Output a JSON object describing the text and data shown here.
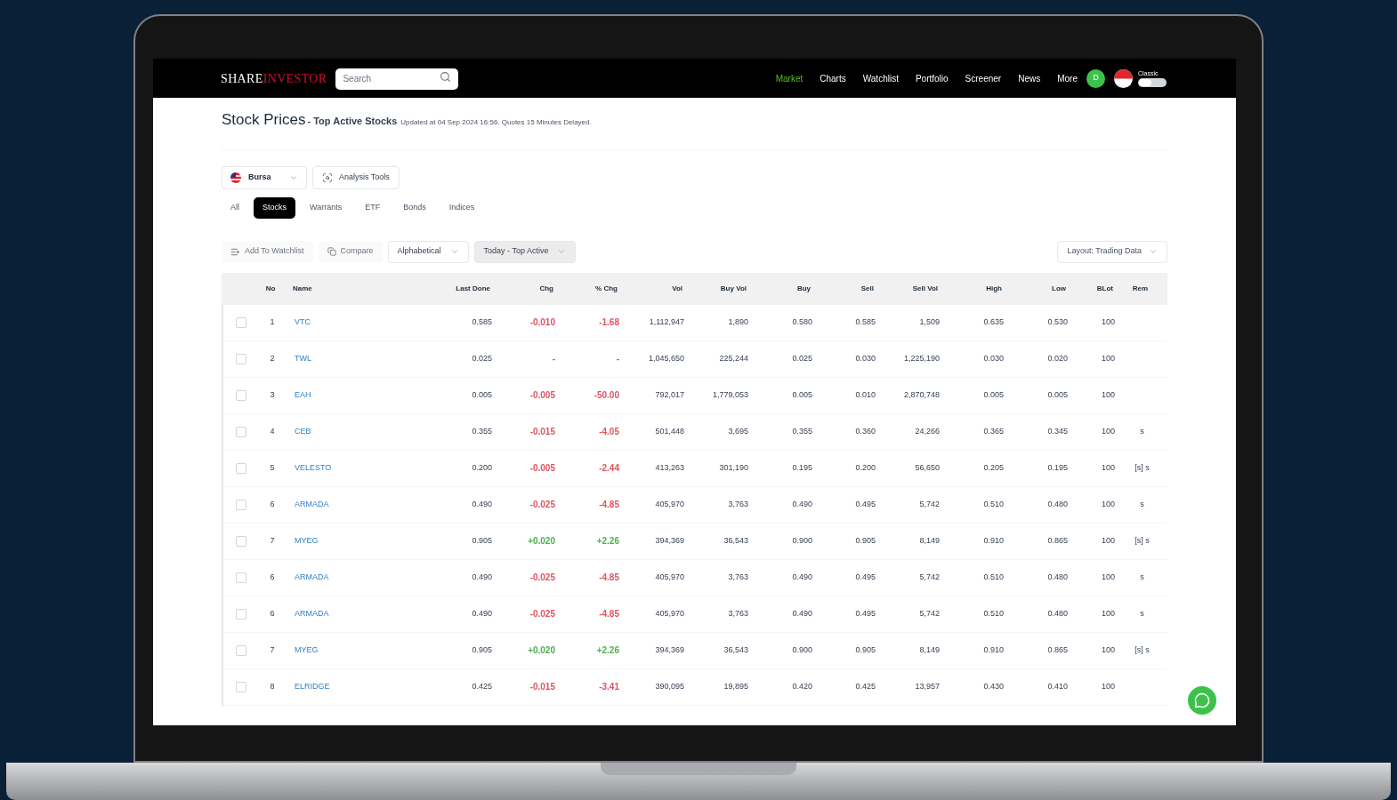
{
  "navbar": {
    "logo": [
      "SHARE",
      "INVESTOR"
    ],
    "search": {
      "placeholder": "Search"
    },
    "links": [
      {
        "label": "Market",
        "selected": true
      },
      {
        "label": "Charts",
        "selected": false
      },
      {
        "label": "Watchlist",
        "selected": false
      },
      {
        "label": "Portfolio",
        "selected": false
      },
      {
        "label": "Screener",
        "selected": false
      },
      {
        "label": "News",
        "selected": false
      },
      {
        "label": "More",
        "selected": false
      }
    ],
    "avatar": "D",
    "classic": {
      "label": "Classic",
      "on": false
    }
  },
  "page": {
    "title": "Stock Prices",
    "subtitle": "- Top Active Stocks",
    "updated": "Updated at 04 Sep 2024 16:56. Quotes 15 Minutes Delayed."
  },
  "market_select": "Bursa",
  "analysis_tools": "Analysis Tools",
  "tabs": [
    {
      "label": "All",
      "selected": false
    },
    {
      "label": "Stocks",
      "selected": true
    },
    {
      "label": "Warrants",
      "selected": false
    },
    {
      "label": "ETF",
      "selected": false
    },
    {
      "label": "Bonds",
      "selected": false
    },
    {
      "label": "Indices",
      "selected": false
    }
  ],
  "toolbar": [
    {
      "kind": "action",
      "label": "Add To Watchlist",
      "disabled": true,
      "selected": false
    },
    {
      "kind": "action",
      "label": "Compare",
      "disabled": true,
      "selected": false
    },
    {
      "kind": "dropdown",
      "label": "Alphabetical",
      "disabled": false,
      "selected": false
    },
    {
      "kind": "dropdown",
      "label": "Today - Top Active",
      "disabled": false,
      "selected": true
    }
  ],
  "layout_select": "Layout: Trading Data",
  "table": {
    "columns": [
      "No",
      "Name",
      "Last Done",
      "Chg",
      "% Chg",
      "Vol",
      "Buy Vol",
      "Buy",
      "Sell",
      "Sell Vol",
      "High",
      "Low",
      "BLot",
      "Rem"
    ],
    "rows": [
      {
        "checked": false,
        "color": "#e0535f",
        "cells": [
          "1",
          "VTC",
          "0.585",
          "-0.010",
          "-1.68",
          "1,112,947",
          "1,890",
          "0.580",
          "0.585",
          "1,509",
          "0.635",
          "0.530",
          "100"
        ]
      },
      {
        "checked": false,
        "cells": [
          "2",
          "TWL",
          "0.025",
          "-",
          "-",
          "1,045,650",
          "225,244",
          "0.025",
          "0.030",
          "1,225,190",
          "0.030",
          "0.020",
          "100"
        ]
      },
      {
        "checked": false,
        "color": "#e0535f",
        "cells": [
          "3",
          "EAH",
          "0.005",
          "-0.005",
          "-50.00",
          "792,017",
          "1,779,053",
          "0.005",
          "0.010",
          "2,870,748",
          "0.005",
          "0.005",
          "100"
        ]
      },
      {
        "checked": false,
        "color": "#e0535f",
        "cells": [
          "4",
          "CEB",
          "0.355",
          "-0.015",
          "-4.05",
          "501,448",
          "3,695",
          "0.355",
          "0.360",
          "24,266",
          "0.365",
          "0.345",
          "100",
          "s"
        ]
      },
      {
        "checked": false,
        "color": "#e0535f",
        "cells": [
          "5",
          "VELESTO",
          "0.200",
          "-0.005",
          "-2.44",
          "413,263",
          "301,190",
          "0.195",
          "0.200",
          "56,650",
          "0.205",
          "0.195",
          "100",
          "[s] s"
        ]
      },
      {
        "checked": false,
        "color": "#e0535f",
        "cells": [
          "6",
          "ARMADA",
          "0.490",
          "-0.025",
          "-4.85",
          "405,970",
          "3,763",
          "0.490",
          "0.495",
          "5,742",
          "0.510",
          "0.480",
          "100",
          "s"
        ]
      },
      {
        "checked": false,
        "color": "#4caf50",
        "cells": [
          "7",
          "MYEG",
          "0.905",
          "+0.020",
          "+2.26",
          "394,369",
          "36,543",
          "0.900",
          "0.905",
          "8,149",
          "0.910",
          "0.865",
          "100",
          "[s] s"
        ]
      },
      {
        "checked": false,
        "color": "#e0535f",
        "cells": [
          "6",
          "ARMADA",
          "0.490",
          "-0.025",
          "-4.85",
          "405,970",
          "3,763",
          "0.490",
          "0.495",
          "5,742",
          "0.510",
          "0.480",
          "100",
          "s"
        ]
      },
      {
        "checked": false,
        "color": "#e0535f",
        "cells": [
          "6",
          "ARMADA",
          "0.490",
          "-0.025",
          "-4.85",
          "405,970",
          "3,763",
          "0.490",
          "0.495",
          "5,742",
          "0.510",
          "0.480",
          "100",
          "s"
        ]
      },
      {
        "checked": false,
        "color": "#4caf50",
        "cells": [
          "7",
          "MYEG",
          "0.905",
          "+0.020",
          "+2.26",
          "394,369",
          "36,543",
          "0.900",
          "0.905",
          "8,149",
          "0.910",
          "0.865",
          "100",
          "[s] s"
        ]
      },
      {
        "checked": false,
        "color": "#e0535f",
        "cells": [
          "8",
          "ELRIDGE",
          "0.425",
          "-0.015",
          "-3.41",
          "390,095",
          "19,895",
          "0.420",
          "0.425",
          "13,957",
          "0.430",
          "0.410",
          "100"
        ]
      }
    ]
  }
}
